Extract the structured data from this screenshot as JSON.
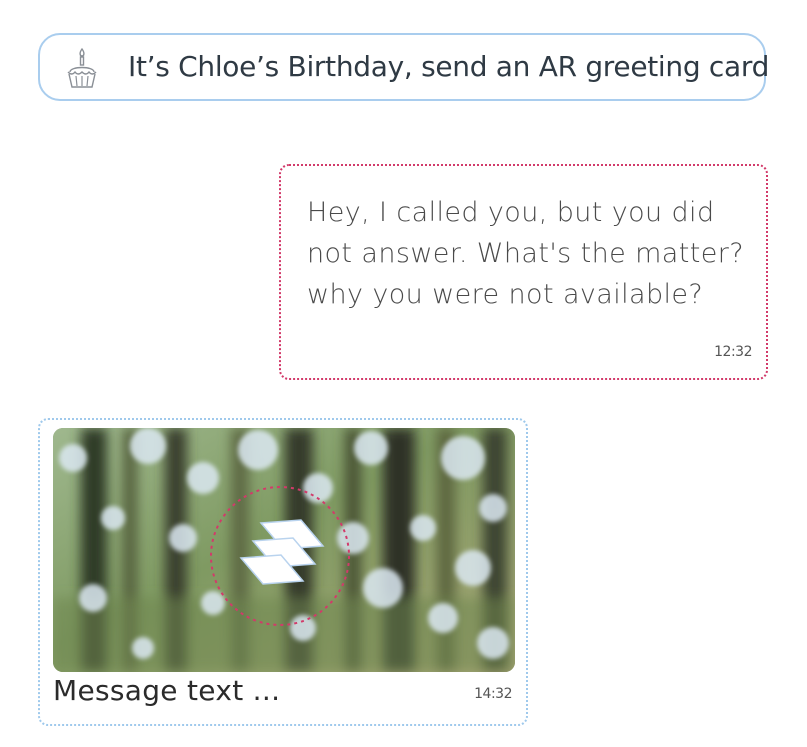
{
  "banner": {
    "icon": "birthday-cake-icon",
    "text": "It’s Chloe’s Birthday, send an AR greeting card",
    "border_color": "#a9cdee"
  },
  "outgoing_message": {
    "text": "Hey, I called you, but you did not answer. What's the matter? why you were not available?",
    "time": "12:32",
    "border_color": "#d23a6a"
  },
  "incoming_card": {
    "image": "blurred-forest-bokeh-photo",
    "ar_marker_icon": "ar-target-icon",
    "caption": "Message text ...",
    "time": "14:32",
    "border_color": "#9fc9ec"
  }
}
